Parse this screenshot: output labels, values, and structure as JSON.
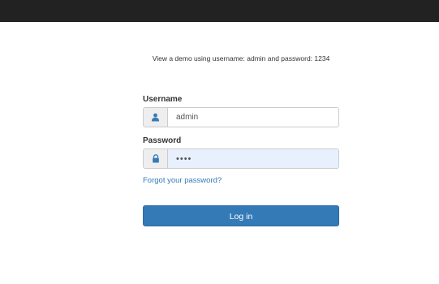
{
  "demo_note": "View a demo using username: admin and password: 1234",
  "form": {
    "username_label": "Username",
    "username_value": "admin",
    "password_label": "Password",
    "password_value": "1234",
    "forgot_link": "Forgot your password?",
    "login_button": "Log in"
  },
  "icons": {
    "username": "user-icon",
    "password": "lock-icon"
  },
  "colors": {
    "topbar": "#222222",
    "primary": "#337ab7",
    "link": "#337ab7",
    "icon": "#337ab7",
    "autofill_background": "#e8f0fe"
  }
}
